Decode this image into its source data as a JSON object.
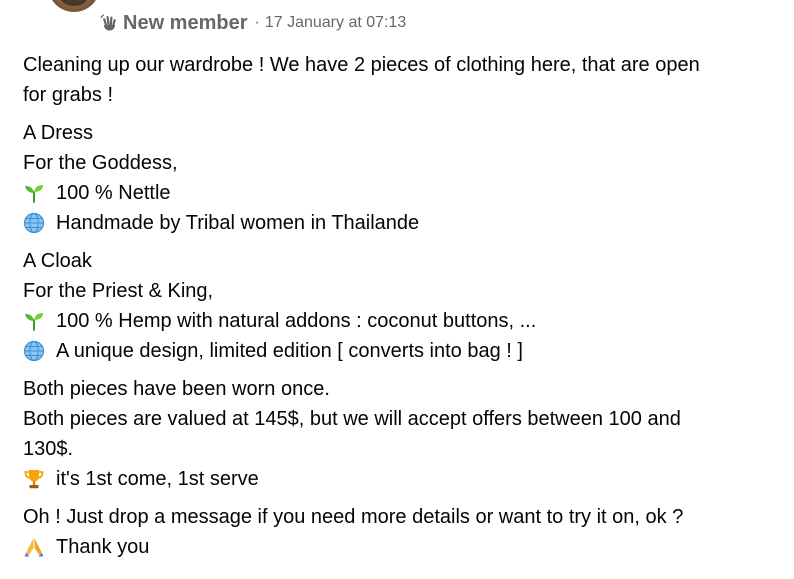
{
  "post": {
    "author_badge": "New member",
    "separator": "·",
    "timestamp": "17 January at 07:13",
    "paragraphs": [
      {
        "lines": [
          {
            "text": "Cleaning up our wardrobe ! We have 2 pieces of clothing here, that are open"
          },
          {
            "text": "for grabs !"
          }
        ]
      },
      {
        "lines": [
          {
            "text": "A Dress"
          },
          {
            "text": "For the Goddess,"
          },
          {
            "icon": "seedling-icon",
            "text": "100 % Nettle"
          },
          {
            "icon": "globe-icon",
            "text": "Handmade by Tribal women in Thailande"
          }
        ]
      },
      {
        "lines": [
          {
            "text": "A Cloak"
          },
          {
            "text": "For the Priest & King,"
          },
          {
            "icon": "seedling-icon",
            "text": "100 % Hemp with natural addons : coconut buttons, ..."
          },
          {
            "icon": "globe-icon",
            "text": "A unique design, limited edition [ converts into bag ! ]"
          }
        ]
      },
      {
        "lines": [
          {
            "text": "Both pieces have been worn once."
          },
          {
            "text": "Both pieces are valued at 145$, but we will accept offers between 100 and"
          },
          {
            "text": "130$."
          },
          {
            "icon": "trophy-icon",
            "text": "it's 1st come, 1st serve"
          }
        ]
      },
      {
        "lines": [
          {
            "text": "Oh ! Just drop a message if you need more details or want to try it on, ok ?"
          },
          {
            "icon": "folded-hands-icon",
            "text": "Thank you"
          }
        ]
      }
    ]
  }
}
